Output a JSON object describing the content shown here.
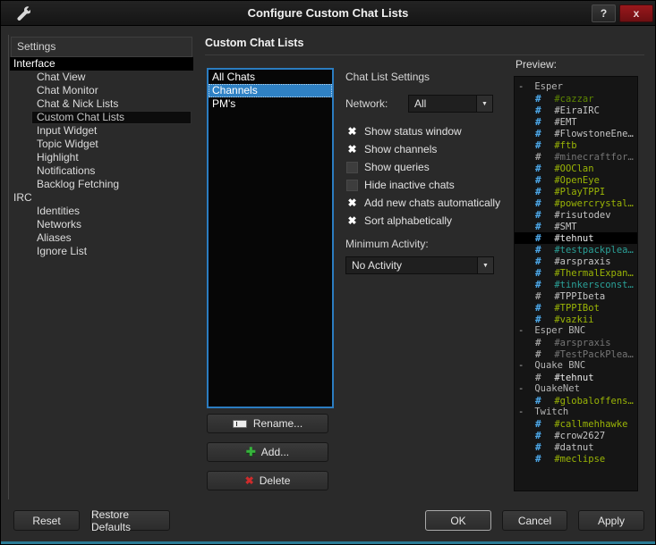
{
  "window": {
    "title": "Configure Custom Chat Lists",
    "help_glyph": "?",
    "close_glyph": "x"
  },
  "icons": {
    "channel_hash": "#",
    "collapse": "-",
    "check": "✖",
    "plus": "✚",
    "cross": "✖",
    "down_arrow": "▼"
  },
  "colors": {
    "selection_blue": "#2f81c4",
    "list_border_blue": "#2b7cc0",
    "green": "#9ab406",
    "green_dark": "#5e8700",
    "teal": "#2aa198",
    "dim": "#757575",
    "gray_text": "#c4c4c4",
    "white_text": "#e8e8e8",
    "net_text": "#b5b5b5",
    "icon_blue": "#4da3e0",
    "icon_gray": "#9a9a9a",
    "icon_add_green": "#36b33c",
    "icon_delete_red": "#cf2b2b",
    "close_red": "#8c1418",
    "edge_teal": "#2a7b95"
  },
  "sidebar": {
    "header": "Settings",
    "items": [
      {
        "label": "Interface",
        "depth": "top",
        "state": "selected"
      },
      {
        "label": "Chat View",
        "depth": "child"
      },
      {
        "label": "Chat Monitor",
        "depth": "child"
      },
      {
        "label": "Chat & Nick Lists",
        "depth": "child"
      },
      {
        "label": "Custom Chat Lists",
        "depth": "child",
        "state": "current"
      },
      {
        "label": "Input Widget",
        "depth": "child"
      },
      {
        "label": "Topic Widget",
        "depth": "child"
      },
      {
        "label": "Highlight",
        "depth": "child"
      },
      {
        "label": "Notifications",
        "depth": "child"
      },
      {
        "label": "Backlog Fetching",
        "depth": "child"
      },
      {
        "label": "IRC",
        "depth": "top"
      },
      {
        "label": "Identities",
        "depth": "child"
      },
      {
        "label": "Networks",
        "depth": "child"
      },
      {
        "label": "Aliases",
        "depth": "child"
      },
      {
        "label": "Ignore List",
        "depth": "child"
      }
    ]
  },
  "main": {
    "title": "Custom Chat Lists",
    "chat_lists": [
      {
        "label": "All Chats"
      },
      {
        "label": "Channels",
        "state": "selected"
      },
      {
        "label": "PM's"
      }
    ],
    "list_buttons": {
      "rename": "Rename...",
      "add": "Add...",
      "delete": "Delete"
    },
    "settings": {
      "title": "Chat List Settings",
      "network_label": "Network:",
      "network_value": "All",
      "checkboxes": [
        {
          "label": "Show status window",
          "state": "checked"
        },
        {
          "label": "Show channels",
          "state": "checked"
        },
        {
          "label": "Show queries",
          "state": "unchecked"
        },
        {
          "label": "Hide inactive chats",
          "state": "unchecked"
        },
        {
          "label": "Add new chats automatically",
          "state": "checked"
        },
        {
          "label": "Sort alphabetically",
          "state": "checked"
        }
      ],
      "min_activity_label": "Minimum Activity:",
      "min_activity_value": "No Activity"
    }
  },
  "preview": {
    "label": "Preview:",
    "tree": [
      {
        "kind": "network",
        "label": "Esper",
        "color": "net"
      },
      {
        "kind": "channel",
        "label": "#cazzar",
        "color": "green-dark",
        "icon": "blue"
      },
      {
        "kind": "channel",
        "label": "#EiraIRC",
        "color": "gray",
        "icon": "blue"
      },
      {
        "kind": "channel",
        "label": "#EMT",
        "color": "gray",
        "icon": "blue"
      },
      {
        "kind": "channel",
        "label": "#FlowstoneEne…",
        "color": "gray",
        "icon": "blue"
      },
      {
        "kind": "channel",
        "label": "#ftb",
        "color": "green",
        "icon": "blue"
      },
      {
        "kind": "channel",
        "label": "#minecraftfor…",
        "color": "dim",
        "icon": "gray"
      },
      {
        "kind": "channel",
        "label": "#OOClan",
        "color": "green",
        "icon": "blue"
      },
      {
        "kind": "channel",
        "label": "#OpenEye",
        "color": "green",
        "icon": "blue"
      },
      {
        "kind": "channel",
        "label": "#PlayTPPI",
        "color": "green",
        "icon": "blue"
      },
      {
        "kind": "channel",
        "label": "#powercrystal…",
        "color": "green",
        "icon": "blue"
      },
      {
        "kind": "channel",
        "label": "#risutodev",
        "color": "gray",
        "icon": "blue"
      },
      {
        "kind": "channel",
        "label": "#SMT",
        "color": "gray",
        "icon": "blue"
      },
      {
        "kind": "channel",
        "label": "#tehnut",
        "color": "white",
        "icon": "blue",
        "state": "hl"
      },
      {
        "kind": "channel",
        "label": "#testpackplea…",
        "color": "teal",
        "icon": "blue"
      },
      {
        "kind": "channel",
        "label": "#arspraxis",
        "color": "gray",
        "icon": "blue"
      },
      {
        "kind": "channel",
        "label": "#ThermalExpan…",
        "color": "green",
        "icon": "blue"
      },
      {
        "kind": "channel",
        "label": "#tinkersconst…",
        "color": "teal",
        "icon": "blue"
      },
      {
        "kind": "channel",
        "label": "#TPPIbeta",
        "color": "gray",
        "icon": "gray"
      },
      {
        "kind": "channel",
        "label": "#TPPIBot",
        "color": "green",
        "icon": "blue"
      },
      {
        "kind": "channel",
        "label": "#vazkii",
        "color": "green",
        "icon": "blue"
      },
      {
        "kind": "network",
        "label": "Esper BNC",
        "color": "net"
      },
      {
        "kind": "channel",
        "label": "#arspraxis",
        "color": "dim",
        "icon": "gray"
      },
      {
        "kind": "channel",
        "label": "#TestPackPlea…",
        "color": "dim",
        "icon": "gray"
      },
      {
        "kind": "network",
        "label": "Quake BNC",
        "color": "net"
      },
      {
        "kind": "channel",
        "label": "#tehnut",
        "color": "white",
        "icon": "gray"
      },
      {
        "kind": "network",
        "label": "QuakeNet",
        "color": "net"
      },
      {
        "kind": "channel",
        "label": "#globaloffens…",
        "color": "green",
        "icon": "blue"
      },
      {
        "kind": "network",
        "label": "Twitch",
        "color": "net"
      },
      {
        "kind": "channel",
        "label": "#callmehhawke",
        "color": "green",
        "icon": "blue"
      },
      {
        "kind": "channel",
        "label": "#crow2627",
        "color": "gray",
        "icon": "blue"
      },
      {
        "kind": "channel",
        "label": "#datnut",
        "color": "gray",
        "icon": "blue"
      },
      {
        "kind": "channel",
        "label": "#meclipse",
        "color": "green",
        "icon": "blue"
      }
    ]
  },
  "footer": {
    "reset": "Reset",
    "restore_defaults": "Restore Defaults",
    "ok": "OK",
    "cancel": "Cancel",
    "apply": "Apply"
  }
}
